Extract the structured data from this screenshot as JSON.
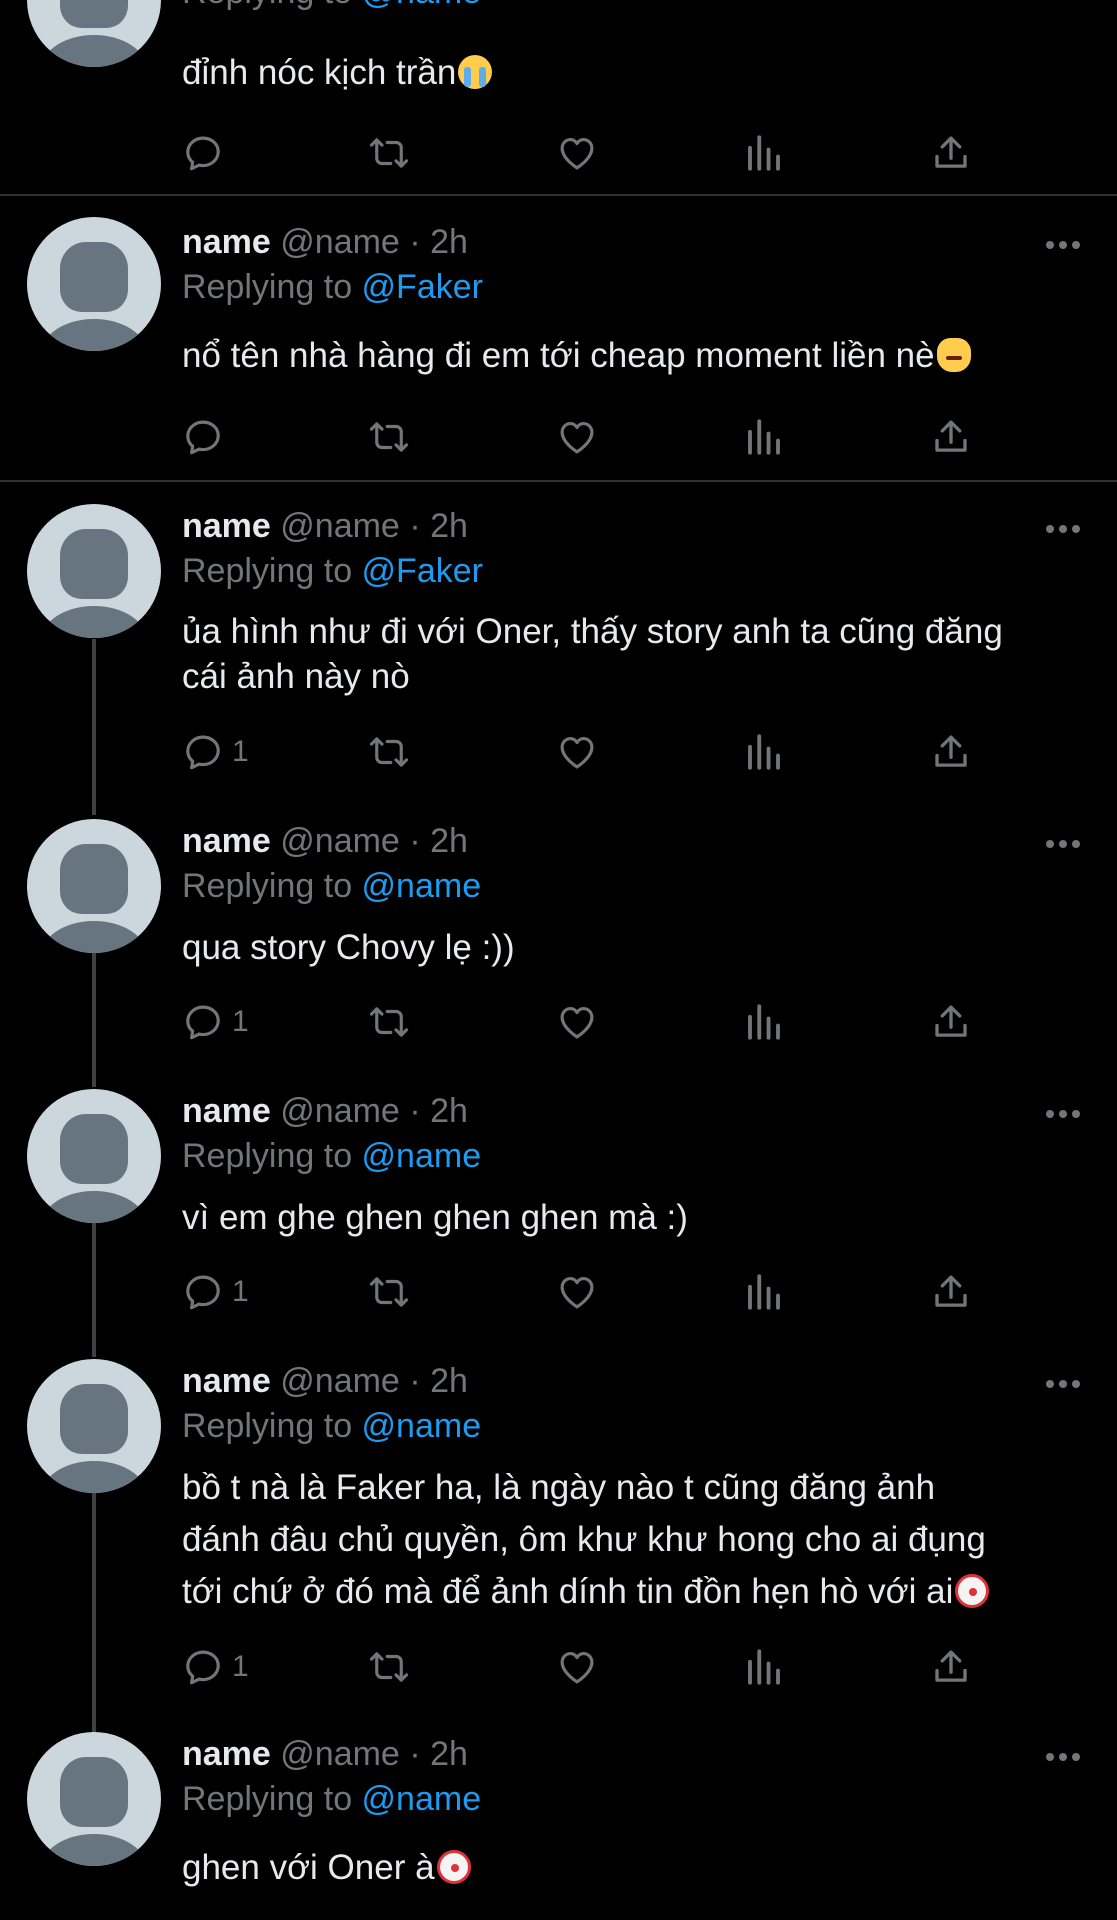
{
  "colors": {
    "background": "#000000",
    "text_primary": "#e7e9ea",
    "text_secondary": "#71767b",
    "mention": "#1d9bf0",
    "divider": "#2f3336",
    "avatar_bg": "#ccd6dd",
    "avatar_fg": "#66757f"
  },
  "tweets": [
    {
      "reply_prefix": "Replying to ",
      "reply_to": "@name",
      "text": "đỉnh nóc kịch trần",
      "emoji": "loudly-crying-face",
      "reply_count": "",
      "partial": true
    },
    {
      "name": "name",
      "handle": "@name",
      "dot": "·",
      "time": "2h",
      "reply_prefix": "Replying to ",
      "reply_to": "@Faker",
      "text": "nổ tên nhà hàng đi em tới cheap moment liền nè",
      "emoji": "pouting-cat-face",
      "reply_count": ""
    },
    {
      "name": "name",
      "handle": "@name",
      "dot": "·",
      "time": "2h",
      "reply_prefix": "Replying to ",
      "reply_to": "@Faker",
      "text": "ủa hình như đi với Oner, thấy story anh ta cũng đăng\ncái ảnh này nò",
      "reply_count": "1"
    },
    {
      "name": "name",
      "handle": "@name",
      "dot": "·",
      "time": "2h",
      "reply_prefix": "Replying to ",
      "reply_to": "@name",
      "text": "qua story Chovy lẹ :))",
      "reply_count": "1"
    },
    {
      "name": "name",
      "handle": "@name",
      "dot": "·",
      "time": "2h",
      "reply_prefix": "Replying to ",
      "reply_to": "@name",
      "text": "vì em ghe ghen ghen ghen mà :)",
      "reply_count": "1"
    },
    {
      "name": "name",
      "handle": "@name",
      "dot": "·",
      "time": "2h",
      "reply_prefix": "Replying to ",
      "reply_to": "@name",
      "text": "bồ t nà là Faker ha, là ngày nào t cũng đăng ảnh\nđánh đâu chủ quyền, ôm khư khư hong cho ai đụng\ntới chứ ở đó mà để ảnh dính tin đồn hẹn hò với ai",
      "emoji": "clown-face",
      "reply_count": "1"
    },
    {
      "name": "name",
      "handle": "@name",
      "dot": "·",
      "time": "2h",
      "reply_prefix": "Replying to ",
      "reply_to": "@name",
      "text": "ghen với Oner à",
      "emoji": "clown-face",
      "reply_count": ""
    }
  ],
  "icons": {
    "reply": "reply-icon",
    "retweet": "retweet-icon",
    "like": "like-icon",
    "views": "views-icon",
    "share": "share-icon",
    "more": "more-icon"
  }
}
